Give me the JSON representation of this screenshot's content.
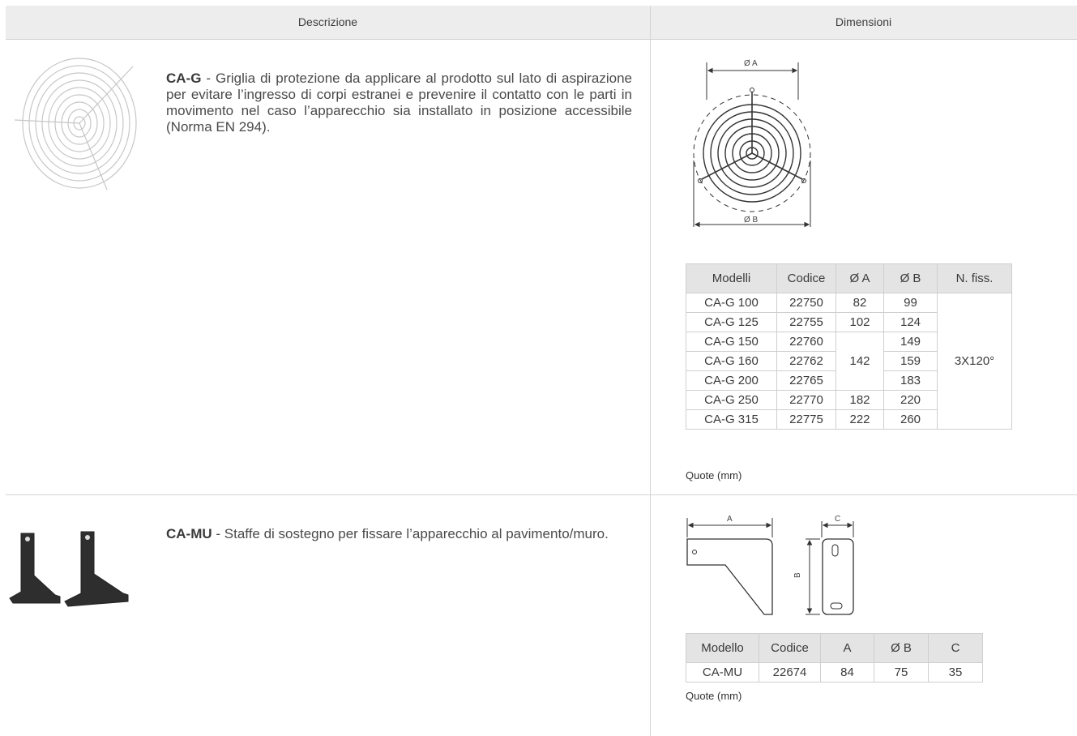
{
  "header": {
    "col_description": "Descrizione",
    "col_dimensions": "Dimensioni"
  },
  "rows": [
    {
      "code": "CA-G",
      "text": " - Griglia di protezione da applicare al prodotto sul lato di aspirazione per evitare l’ingresso di corpi estranei e prevenire il contatto con le parti in movimento nel caso l’apparecchio sia installato in posizione accessibile (Norma EN 294).",
      "drawing_labels": {
        "a": "Ø A",
        "b": "Ø B"
      },
      "table": {
        "headers": [
          "Modelli",
          "Codice",
          "Ø A",
          "Ø B",
          "N. fiss."
        ],
        "rows": [
          [
            "CA-G 100",
            "22750",
            "82",
            "99"
          ],
          [
            "CA-G 125",
            "22755",
            "102",
            "124"
          ],
          [
            "CA-G 150",
            "22760",
            "",
            "149"
          ],
          [
            "CA-G 160",
            "22762",
            "142",
            "159"
          ],
          [
            "CA-G 200",
            "22765",
            "",
            "183"
          ],
          [
            "CA-G 250",
            "22770",
            "182",
            "220"
          ],
          [
            "CA-G 315",
            "22775",
            "222",
            "260"
          ]
        ],
        "merged_oa_142": "142",
        "fixings": "3X120°"
      },
      "note": "Quote (mm)"
    },
    {
      "code": "CA-MU",
      "text": " - Staffe di sostegno per fissare l’apparecchio al pavimento/muro.",
      "drawing_labels": {
        "a": "A",
        "b": "B",
        "c": "C"
      },
      "table": {
        "headers": [
          "Modello",
          "Codice",
          "A",
          "Ø B",
          "C"
        ],
        "row": [
          "CA-MU",
          "22674",
          "84",
          "75",
          "35"
        ]
      },
      "note": "Quote (mm)"
    }
  ]
}
